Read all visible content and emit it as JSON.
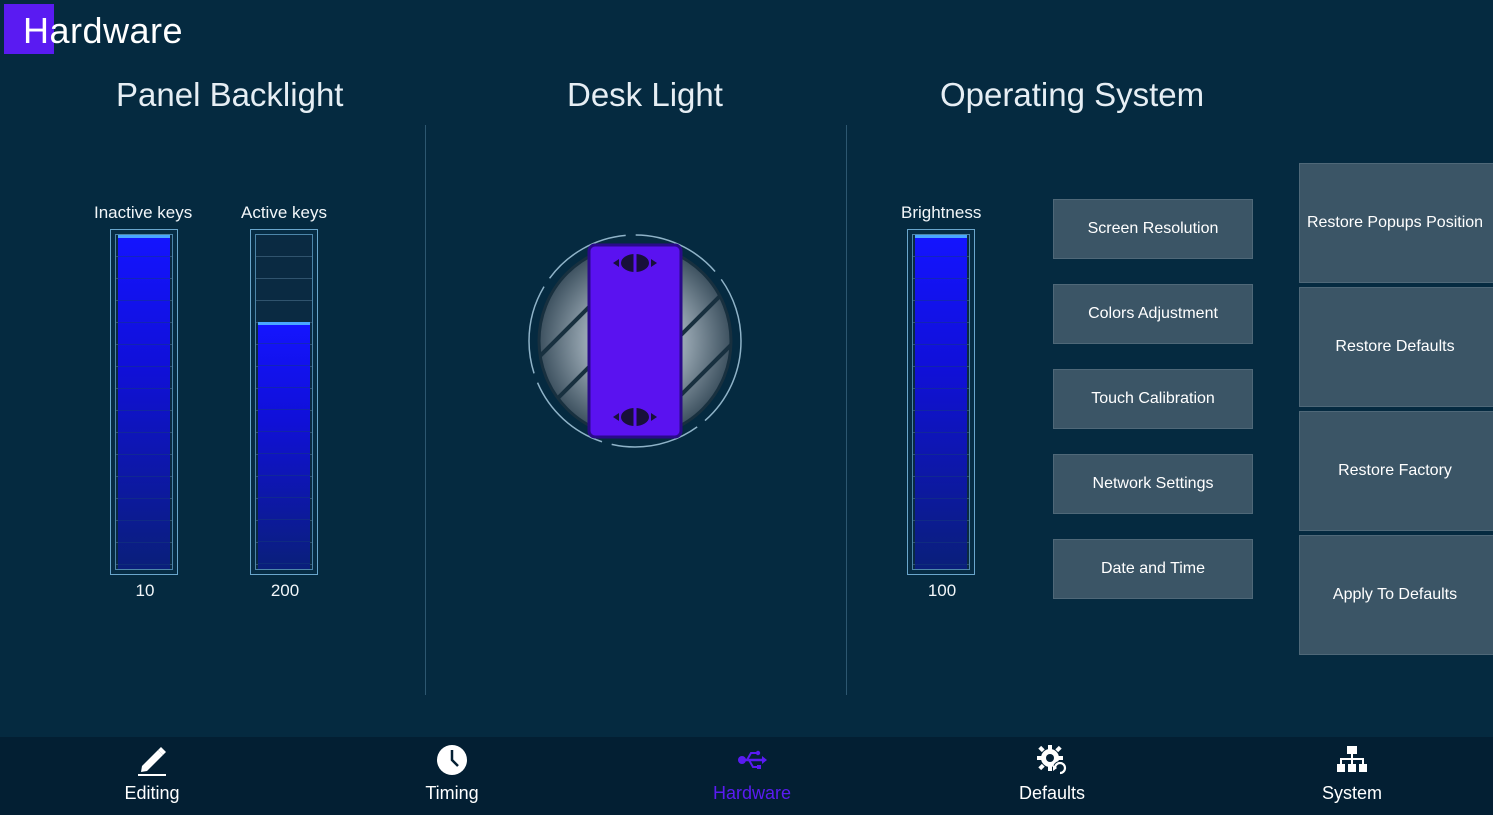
{
  "page": {
    "title": "Hardware",
    "accent_color": "#5a1bf2"
  },
  "panel_backlight": {
    "title": "Panel Backlight",
    "sliders": [
      {
        "label": "Inactive keys",
        "value": "10",
        "fill_fraction": 1.0
      },
      {
        "label": "Active keys",
        "value": "200",
        "fill_fraction": 0.74
      }
    ]
  },
  "desk_light": {
    "title": "Desk Light",
    "icon": "desk-light-toggle-icon"
  },
  "operating_system": {
    "title": "Operating System",
    "brightness": {
      "label": "Brightness",
      "value": "100",
      "fill_fraction": 1.0
    },
    "buttons": [
      "Screen Resolution",
      "Colors Adjustment",
      "Touch Calibration",
      "Network Settings",
      "Date and Time"
    ],
    "restore_buttons": [
      "Restore Popups Position",
      "Restore Defaults",
      "Restore Factory",
      "Apply To Defaults"
    ]
  },
  "bottom_nav": {
    "items": [
      {
        "label": "Editing",
        "icon": "pencil-icon",
        "active": false
      },
      {
        "label": "Timing",
        "icon": "clock-icon",
        "active": false
      },
      {
        "label": "Hardware",
        "icon": "usb-icon",
        "active": true
      },
      {
        "label": "Defaults",
        "icon": "gear-refresh-icon",
        "active": false
      },
      {
        "label": "System",
        "icon": "network-hierarchy-icon",
        "active": false
      }
    ]
  }
}
